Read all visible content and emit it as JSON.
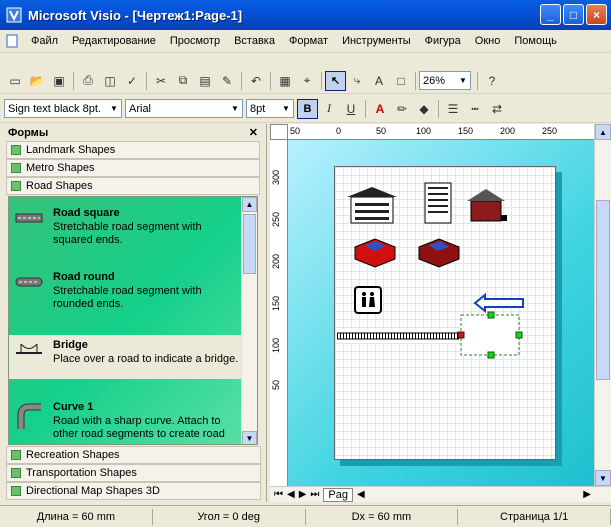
{
  "window": {
    "title": "Microsoft Visio - [Чертеж1:Page-1]"
  },
  "menu": [
    "Файл",
    "Редактирование",
    "Просмотр",
    "Вставка",
    "Формат",
    "Инструменты",
    "Фигура",
    "Окно",
    "Помощь"
  ],
  "toolbar": {
    "zoom": "26%"
  },
  "format": {
    "style": "Sign text black 8pt.",
    "font": "Arial",
    "size": "8pt",
    "bold": "B",
    "italic": "I",
    "underline": "U"
  },
  "shapes_panel": {
    "title": "Формы",
    "stencils_top": [
      "Landmark Shapes",
      "Metro Shapes",
      "Road Shapes"
    ],
    "items": [
      {
        "name": "Road square",
        "desc": "Stretchable road segment with squared ends."
      },
      {
        "name": "Road round",
        "desc": "Stretchable road segment with rounded ends."
      },
      {
        "name": "Bridge",
        "desc": "Place over a road to indicate a bridge."
      },
      {
        "name": "Curve 1",
        "desc": "Road with a sharp curve. Attach to other road segments to create road"
      }
    ],
    "stencils_bottom": [
      "Recreation Shapes",
      "Transportation Shapes",
      "Directional Map Shapes 3D"
    ]
  },
  "ruler": {
    "h": [
      "50",
      "0",
      "50",
      "100",
      "150",
      "200",
      "250"
    ],
    "v": [
      "300",
      "250",
      "200",
      "150",
      "100",
      "50"
    ]
  },
  "page_tab": "Pag",
  "status": {
    "length": "Длина = 60 mm",
    "angle": "Угол = 0 deg",
    "dx": "Dx = 60 mm",
    "page": "Страница 1/1"
  },
  "colors": {
    "titlebar": "#0453d8",
    "stencil_bg": "#14d08a",
    "canvas_bg": "#40d4e0"
  }
}
